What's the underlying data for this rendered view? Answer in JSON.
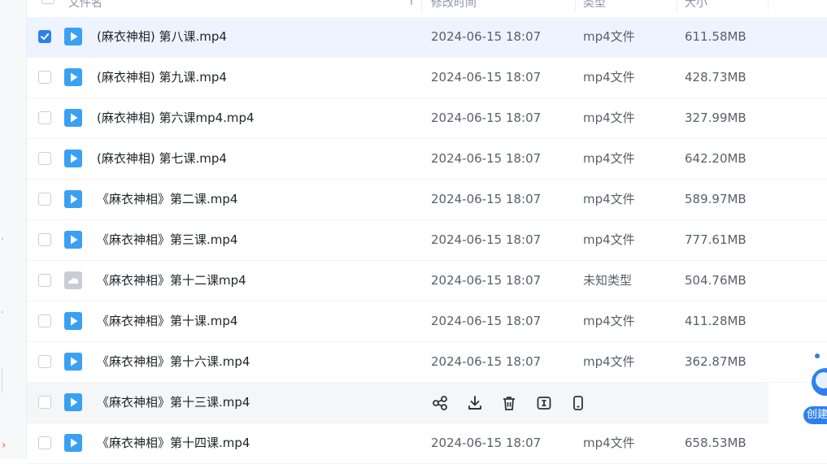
{
  "header": {
    "name": "文件名",
    "modified": "修改时间",
    "type": "类型",
    "size": "大小"
  },
  "rows": [
    {
      "name": "(麻衣神相) 第八课.mp4",
      "time": "2024-06-15 18:07",
      "type": "mp4文件",
      "size": "611.58MB",
      "checked": true,
      "icon": "video-file-icon"
    },
    {
      "name": "(麻衣神相) 第九课.mp4",
      "time": "2024-06-15 18:07",
      "type": "mp4文件",
      "size": "428.73MB",
      "checked": false,
      "icon": "video-file-icon"
    },
    {
      "name": "(麻衣神相) 第六课mp4.mp4",
      "time": "2024-06-15 18:07",
      "type": "mp4文件",
      "size": "327.99MB",
      "checked": false,
      "icon": "video-file-icon"
    },
    {
      "name": "(麻衣神相) 第七课.mp4",
      "time": "2024-06-15 18:07",
      "type": "mp4文件",
      "size": "642.20MB",
      "checked": false,
      "icon": "video-file-icon"
    },
    {
      "name": "《麻衣神相》第二课.mp4",
      "time": "2024-06-15 18:07",
      "type": "mp4文件",
      "size": "589.97MB",
      "checked": false,
      "icon": "video-file-icon"
    },
    {
      "name": "《麻衣神相》第三课.mp4",
      "time": "2024-06-15 18:07",
      "type": "mp4文件",
      "size": "777.61MB",
      "checked": false,
      "icon": "video-file-icon"
    },
    {
      "name": "《麻衣神相》第十二课mp4",
      "time": "2024-06-15 18:07",
      "type": "未知类型",
      "size": "504.76MB",
      "checked": false,
      "icon": "unknown-file-icon"
    },
    {
      "name": "《麻衣神相》第十课.mp4",
      "time": "2024-06-15 18:07",
      "type": "mp4文件",
      "size": "411.28MB",
      "checked": false,
      "icon": "video-file-icon"
    },
    {
      "name": "《麻衣神相》第十六课.mp4",
      "time": "2024-06-15 18:07",
      "type": "mp4文件",
      "size": "362.87MB",
      "checked": false,
      "icon": "video-file-icon"
    },
    {
      "name": "《麻衣神相》第十三课.mp4",
      "time": "",
      "type": "",
      "size": "",
      "checked": false,
      "icon": "video-file-icon",
      "hover_actions": [
        "share-icon",
        "download-icon",
        "delete-icon",
        "rename-icon",
        "send-to-phone-icon"
      ]
    },
    {
      "name": "《麻衣神相》第十四课.mp4",
      "time": "2024-06-15 18:07",
      "type": "mp4文件",
      "size": "658.53MB",
      "checked": false,
      "icon": "video-file-icon"
    }
  ],
  "widget": {
    "label": "创建"
  },
  "colors": {
    "accent": "#2f80ed",
    "video_icon": "#3aa0f3",
    "unknown_icon": "#c9ced6",
    "selected_row": "#eef4ff"
  }
}
